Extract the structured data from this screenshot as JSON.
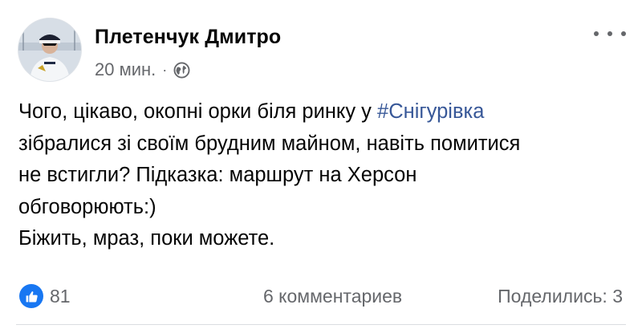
{
  "post": {
    "author": "Плетенчук Дмитро",
    "timestamp": "20 мин.",
    "separator": "·",
    "visibility_icon": "globe-icon",
    "more_icon": "more-horizontal-icon",
    "body": {
      "line1_text": "Чого, цікаво, окопні орки біля ринку у ",
      "line1_hashtag": "#Снігурівка",
      "line2": "зібралися зі своїм брудним майном, навіть помитися",
      "line3": "не встигли? Підказка: маршрут на Херсон",
      "line4": "обговорюють:)",
      "line5": "Біжить, мраз, поки можете."
    },
    "reactions": {
      "icon": "like-icon",
      "count": "81"
    },
    "comments_label": "6 комментариев",
    "shares_label": "Поделились: 3"
  },
  "colors": {
    "accent": "#1877f2",
    "hashtag": "#385898",
    "secondary_text": "#65676b",
    "primary_text": "#050505"
  }
}
